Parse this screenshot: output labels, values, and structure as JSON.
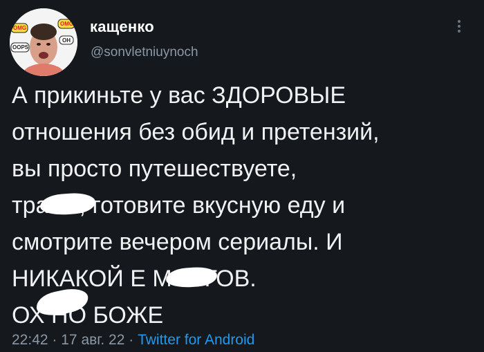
{
  "tweet": {
    "display_name": "кащенко",
    "handle": "@sonvletniuynoch",
    "avatar_stickers": [
      "OMG",
      "OMG",
      "OH",
      "OOPS"
    ],
    "text": "А прикиньте у вас ЗДОРОВЫЕ\nотношения без обид и претензий,\nвы просто путешествуете,\nтра       сь, готовите вкусную еду и\nсмотрите вечером сериалы. И\nНИКАКОЙ Е         МОЗГОВ.\nОХ       НО БОЖЕ",
    "time": "22:42",
    "date": "17 авг. 22",
    "separator": "·",
    "source": "Twitter for Android"
  },
  "colors": {
    "background": "#15181c",
    "text": "#f0f2f3",
    "secondary_text": "#8b98a5",
    "link": "#1d9bf0",
    "censor_blot": "#ffffff"
  },
  "icons": {
    "more": "more-vertical-icon"
  }
}
